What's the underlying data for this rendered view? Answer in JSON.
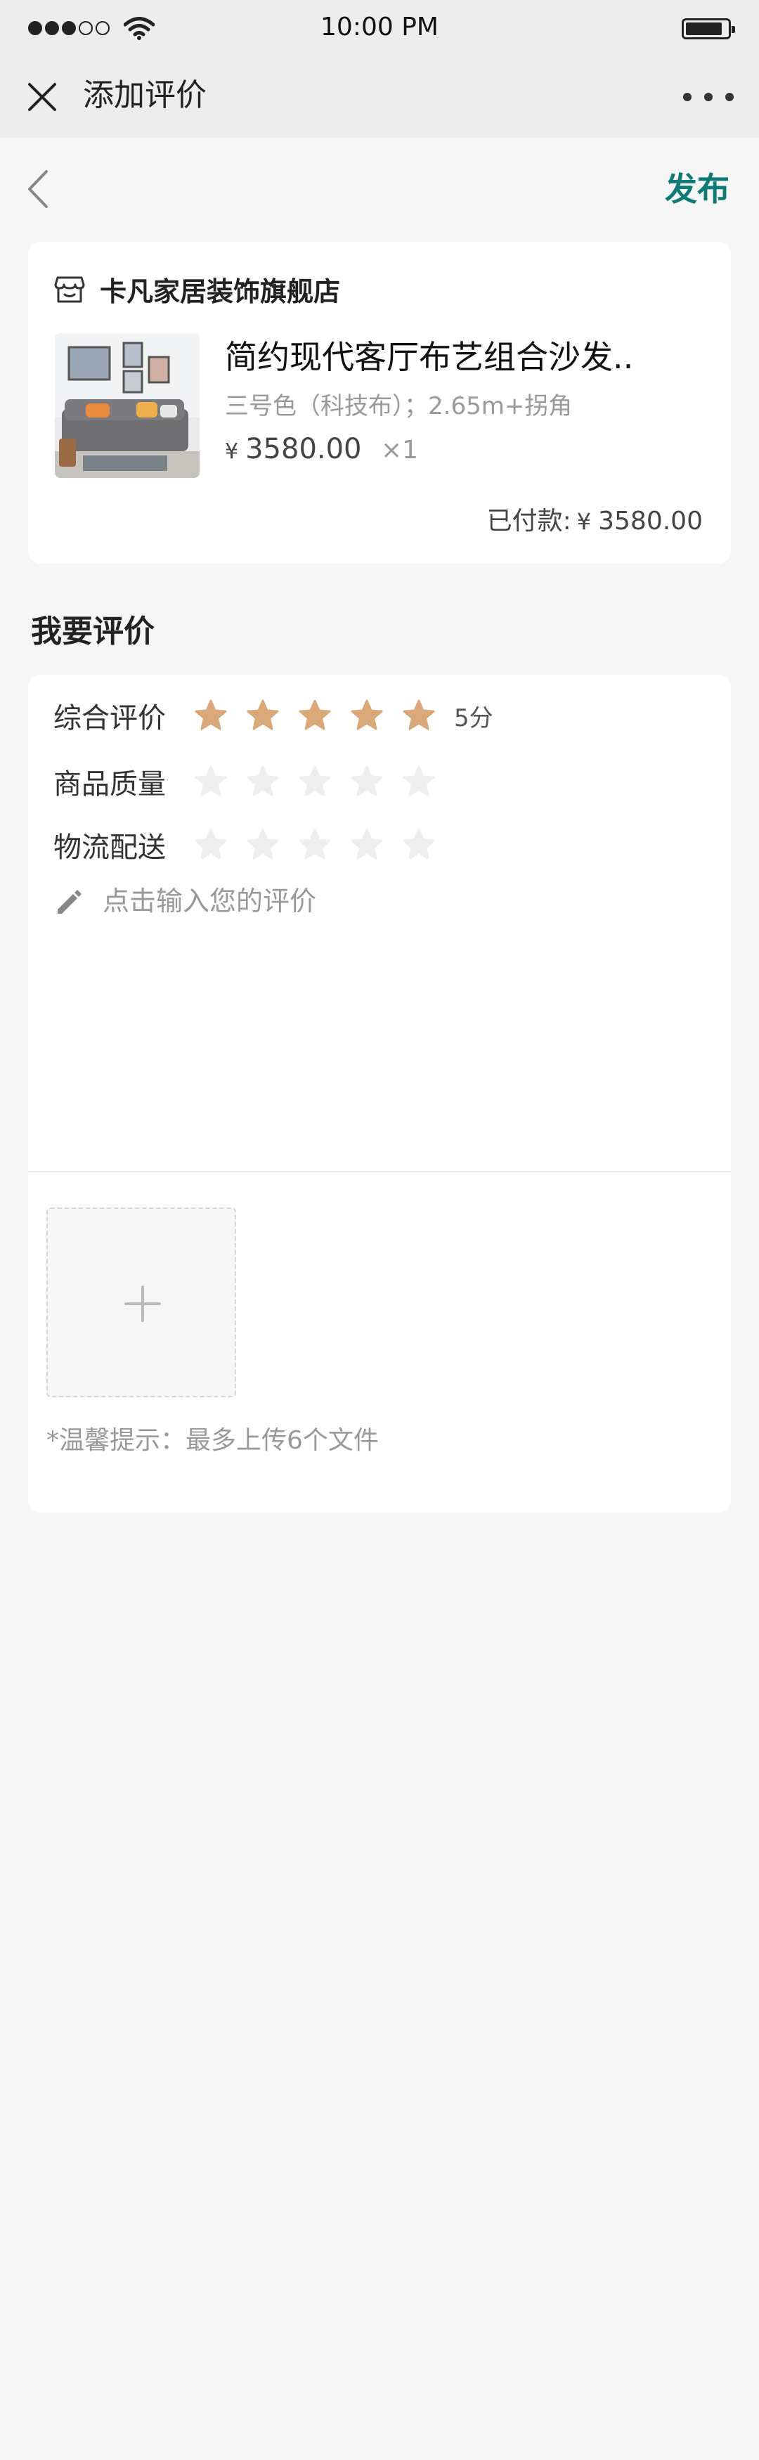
{
  "status_bar": {
    "time": "10:00 PM",
    "signal_filled": 3,
    "signal_total": 5,
    "battery_level": 0.8
  },
  "title_bar": {
    "title": "添加评价",
    "close_icon": "close-icon",
    "more_icon": "more-icon"
  },
  "header": {
    "back_icon": "chevron-left-icon",
    "publish_label": "发布"
  },
  "order": {
    "shop_icon": "shop-icon",
    "shop_name": "卡凡家居装饰旗舰店",
    "product_title": "简约现代客厅布艺组合沙发..",
    "product_spec": "三号色（科技布）；2.65m+拐角",
    "price_symbol": "¥",
    "price": "3580.00",
    "quantity": "×1",
    "paid_label": "已付款:",
    "paid_symbol": "¥",
    "paid_amount": "3580.00"
  },
  "review": {
    "section_title": "我要评价",
    "ratings": [
      {
        "label": "综合评价",
        "stars": 5,
        "max": 5,
        "score_text": "5分"
      },
      {
        "label": "商品质量",
        "stars": 0,
        "max": 5
      },
      {
        "label": "物流配送",
        "stars": 0,
        "max": 5
      }
    ],
    "comment_placeholder": "点击输入您的评价",
    "upload_icon": "plus-icon",
    "tip": "*温馨提示：最多上传6个文件"
  },
  "colors": {
    "accent": "#0d7a76",
    "star_active": "#d9a97a",
    "star_inactive": "#eeeeee",
    "page_bg": "#f6f6f6"
  }
}
